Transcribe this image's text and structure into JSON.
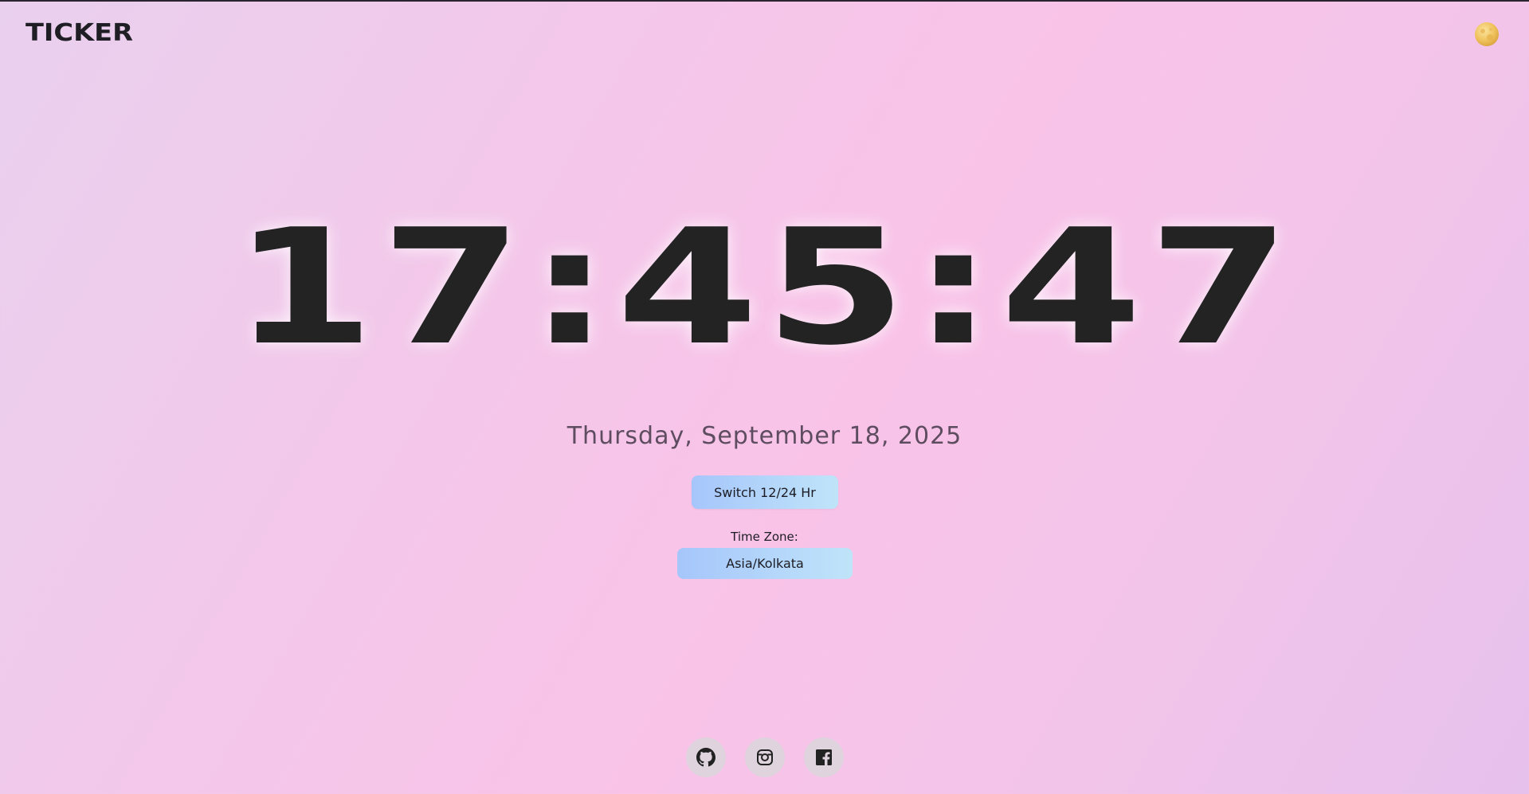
{
  "header": {
    "logo": "TICKER",
    "theme_toggle_icon": "moon-icon"
  },
  "clock": {
    "time": "17:45:47",
    "date": "Thursday, September 18, 2025"
  },
  "controls": {
    "switch_label": "Switch 12/24 Hr",
    "timezone_label": "Time Zone:",
    "timezone_value": "Asia/Kolkata"
  },
  "footer": {
    "links": [
      {
        "name": "github",
        "icon": "github-icon"
      },
      {
        "name": "instagram",
        "icon": "instagram-icon"
      },
      {
        "name": "facebook",
        "icon": "facebook-icon"
      }
    ]
  },
  "colors": {
    "button_gradient_start": "#a6c6fb",
    "button_gradient_end": "#bfe4f9",
    "clock_text": "#232323",
    "date_text": "#5e4c60"
  }
}
